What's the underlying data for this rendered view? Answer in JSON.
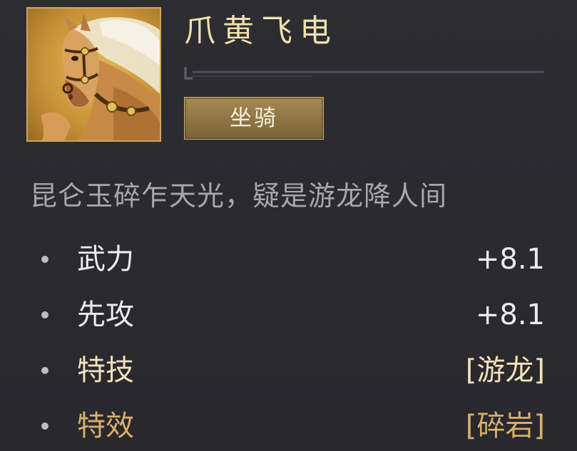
{
  "item": {
    "name": "爪黄飞电",
    "category": "坐骑",
    "description": "昆仑玉碎乍天光，疑是游龙降人间",
    "portrait_icon": "horse-portrait"
  },
  "stats": [
    {
      "label": "武力",
      "value": "+8.1"
    },
    {
      "label": "先攻",
      "value": "+8.1"
    },
    {
      "label": "特技",
      "value": "[游龙]"
    },
    {
      "label": "特效",
      "value": "[碎岩]"
    }
  ],
  "colors": {
    "background": "#2a2a2f",
    "name_text": "#efe0b0",
    "badge_fill": "#8c7244",
    "description_text": "#a7a7ac",
    "stat_white": "#ececef",
    "stat_cream": "#f2e3bc",
    "stat_gold": "#d6b06d"
  }
}
